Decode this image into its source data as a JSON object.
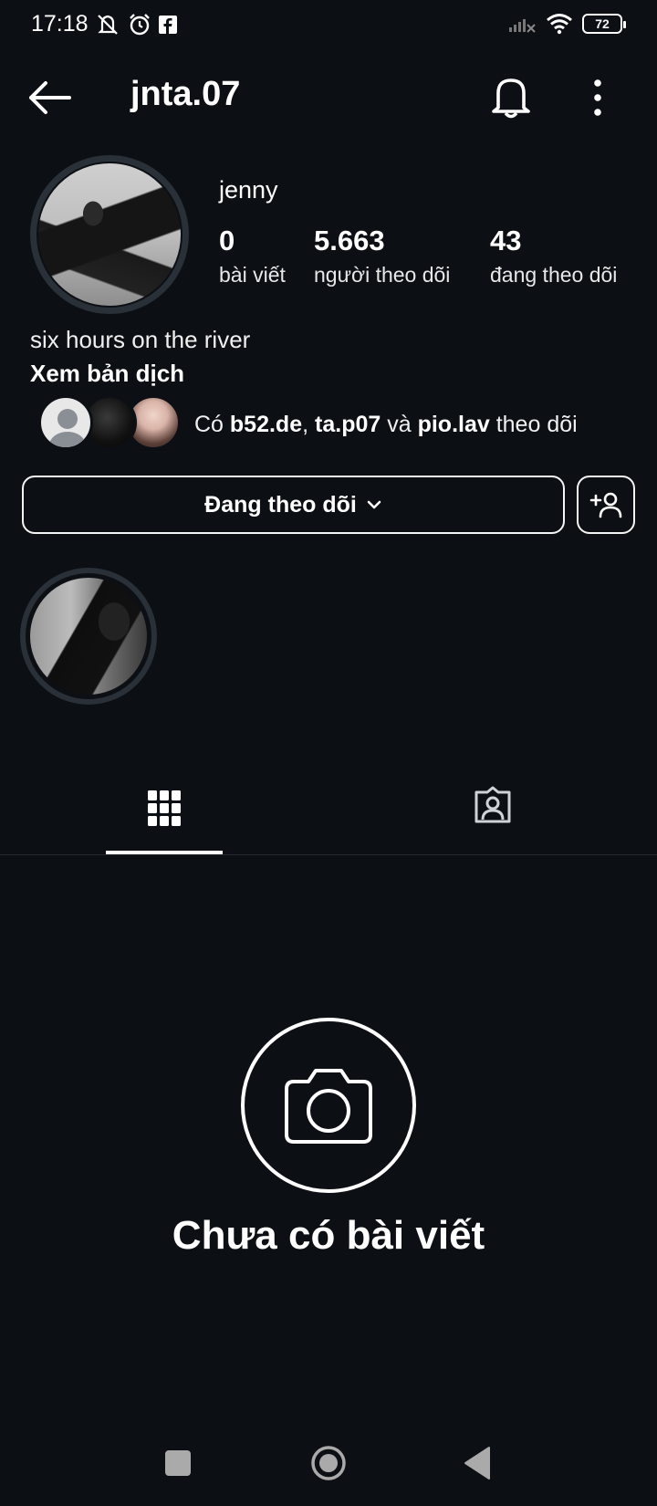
{
  "status_bar": {
    "time": "17:18",
    "battery": "72",
    "icons_left": [
      "mute-notification-icon",
      "alarm-icon",
      "facebook-icon"
    ],
    "icons_right": [
      "signal-icon",
      "wifi-icon",
      "battery-icon"
    ]
  },
  "header": {
    "username": "jnta.07"
  },
  "profile": {
    "display_name": "jenny",
    "stats": [
      {
        "value": "0",
        "label": "bài viết"
      },
      {
        "value": "5.663",
        "label": "người theo dõi"
      },
      {
        "value": "43",
        "label": "đang theo dõi"
      }
    ],
    "bio": "six hours on the river",
    "translate_label": "Xem bản dịch"
  },
  "mutual": {
    "prefix": "Có ",
    "user1": "b52.de",
    "sep1": ", ",
    "user2": "ta.p07",
    "sep2": " và ",
    "user3": "pio.lav",
    "suffix": " theo dõi"
  },
  "actions": {
    "following_label": "Đang theo dõi"
  },
  "empty_state": {
    "title": "Chưa có bài viết"
  },
  "colors": {
    "background": "#0c0f14",
    "text": "#ffffff",
    "divider": "#262a30"
  }
}
